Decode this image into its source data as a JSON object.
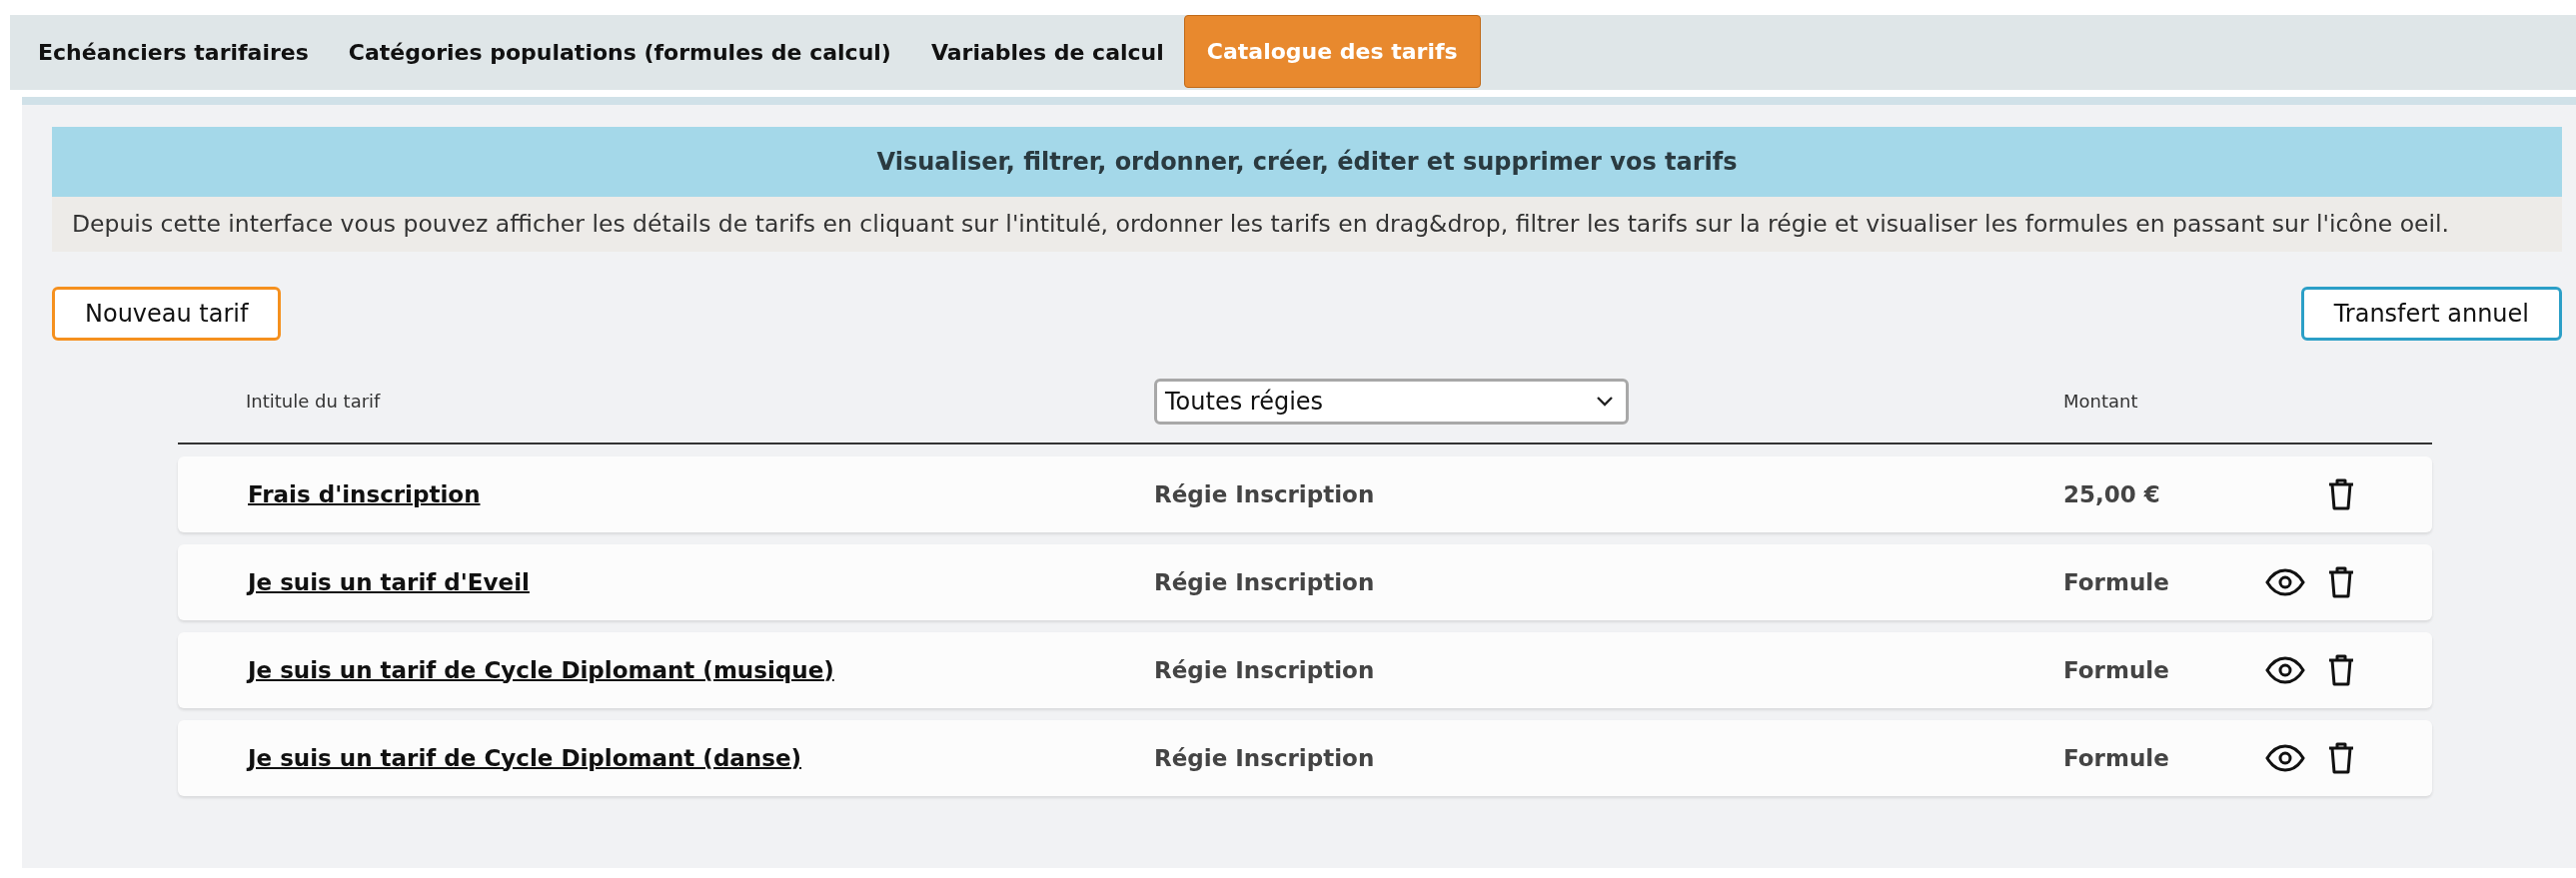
{
  "tabs": [
    {
      "label": "Echéanciers tarifaires",
      "selected": false
    },
    {
      "label": "Catégories populations (formules de calcul)",
      "selected": false
    },
    {
      "label": "Variables de calcul",
      "selected": false
    },
    {
      "label": "Catalogue des tarifs",
      "selected": true
    }
  ],
  "banner": {
    "title": "Visualiser, filtrer, ordonner, créer, éditer et supprimer vos tarifs",
    "description": "Depuis cette interface vous pouvez afficher les détails de tarifs en cliquant sur l'intitulé, ordonner les tarifs en drag&drop, filtrer les tarifs sur la régie et visualiser les formules en passant sur l'icône oeil."
  },
  "actions": {
    "new_button": "Nouveau tarif",
    "transfer_button": "Transfert annuel"
  },
  "table": {
    "columns": {
      "name": "Intitule du tarif",
      "filter_value": "Toutes régies",
      "amount": "Montant"
    },
    "rows": [
      {
        "name": "Frais d'inscription",
        "regie": "Régie Inscription",
        "amount": "25,00 €",
        "preview": false
      },
      {
        "name": "Je suis un tarif d'Eveil",
        "regie": "Régie Inscription",
        "amount": "Formule",
        "preview": true
      },
      {
        "name": "Je suis un tarif de Cycle Diplomant (musique)",
        "regie": "Régie Inscription",
        "amount": "Formule",
        "preview": true
      },
      {
        "name": "Je suis un tarif de Cycle Diplomant (danse)",
        "regie": "Régie Inscription",
        "amount": "Formule",
        "preview": true
      }
    ]
  }
}
